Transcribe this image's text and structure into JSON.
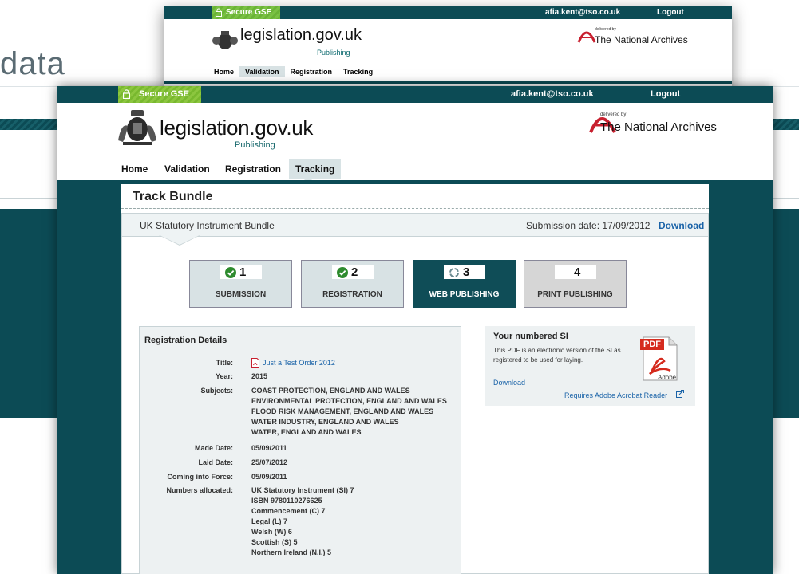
{
  "background": {
    "word": "data"
  },
  "back_window": {
    "secure_label": "Secure GSE",
    "email": "afia.kent@tso.co.uk",
    "logout": "Logout",
    "site_title": "legislation.gov.uk",
    "publishing": "Publishing",
    "tna_small": "delivered by",
    "tna_name": "The National Archives",
    "nav": [
      "Home",
      "Validation",
      "Registration",
      "Tracking"
    ],
    "nav_active": "Validation"
  },
  "header": {
    "secure_label": "Secure GSE",
    "email": "afia.kent@tso.co.uk",
    "logout": "Logout",
    "site_title": "legislation.gov.uk",
    "publishing": "Publishing",
    "tna_small": "delivered by",
    "tna_name": "The National Archives"
  },
  "nav": {
    "items": [
      "Home",
      "Validation",
      "Registration",
      "Tracking"
    ],
    "active": "Tracking"
  },
  "page": {
    "title": "Track Bundle"
  },
  "bundle": {
    "name": "UK Statutory Instrument Bundle",
    "submission_date": "Submission date: 17/09/2012",
    "download": "Download"
  },
  "steps": [
    {
      "number": "1",
      "label": "SUBMISSION",
      "status": "complete"
    },
    {
      "number": "2",
      "label": "REGISTRATION",
      "status": "complete"
    },
    {
      "number": "3",
      "label": "WEB PUBLISHING",
      "status": "in-progress"
    },
    {
      "number": "4",
      "label": "PRINT PUBLISHING",
      "status": "pending"
    }
  ],
  "registration": {
    "heading": "Registration Details",
    "title_label": "Title:",
    "title_value": "Just a Test Order 2012",
    "year_label": "Year:",
    "year_value": "2015",
    "subjects_label": "Subjects:",
    "subjects": [
      "COAST PROTECTION, ENGLAND AND WALES",
      "ENVIRONMENTAL PROTECTION, ENGLAND AND WALES",
      "FLOOD RISK MANAGEMENT, ENGLAND AND WALES",
      "WATER INDUSTRY, ENGLAND AND WALES",
      "WATER, ENGLAND AND WALES"
    ],
    "made_label": "Made Date:",
    "made_value": "05/09/2011",
    "laid_label": "Laid Date:",
    "laid_value": "25/07/2012",
    "force_label": "Coming into Force:",
    "force_value": "05/09/2011",
    "numbers_label": "Numbers allocated:",
    "numbers": [
      "UK Statutory Instrument (SI) 7",
      "ISBN 9780110276625",
      "Commencement (C) 7",
      "Legal (L) 7",
      "Welsh (W) 6",
      "Scottish (S) 5",
      "Northern Ireland (N.I.) 5"
    ]
  },
  "numbered_si": {
    "heading": "Your numbered SI",
    "description": "This PDF is an electronic version of the SI as registered to be used for laying.",
    "download": "Download",
    "reader": "Requires Adobe Acrobat Reader",
    "pdf_badge": "PDF",
    "adobe": "Adobe"
  },
  "colors": {
    "brand_teal": "#0c4b55",
    "secure_green": "#8cc63f",
    "link_blue": "#1a63a8",
    "check_green": "#2e8b2e"
  }
}
